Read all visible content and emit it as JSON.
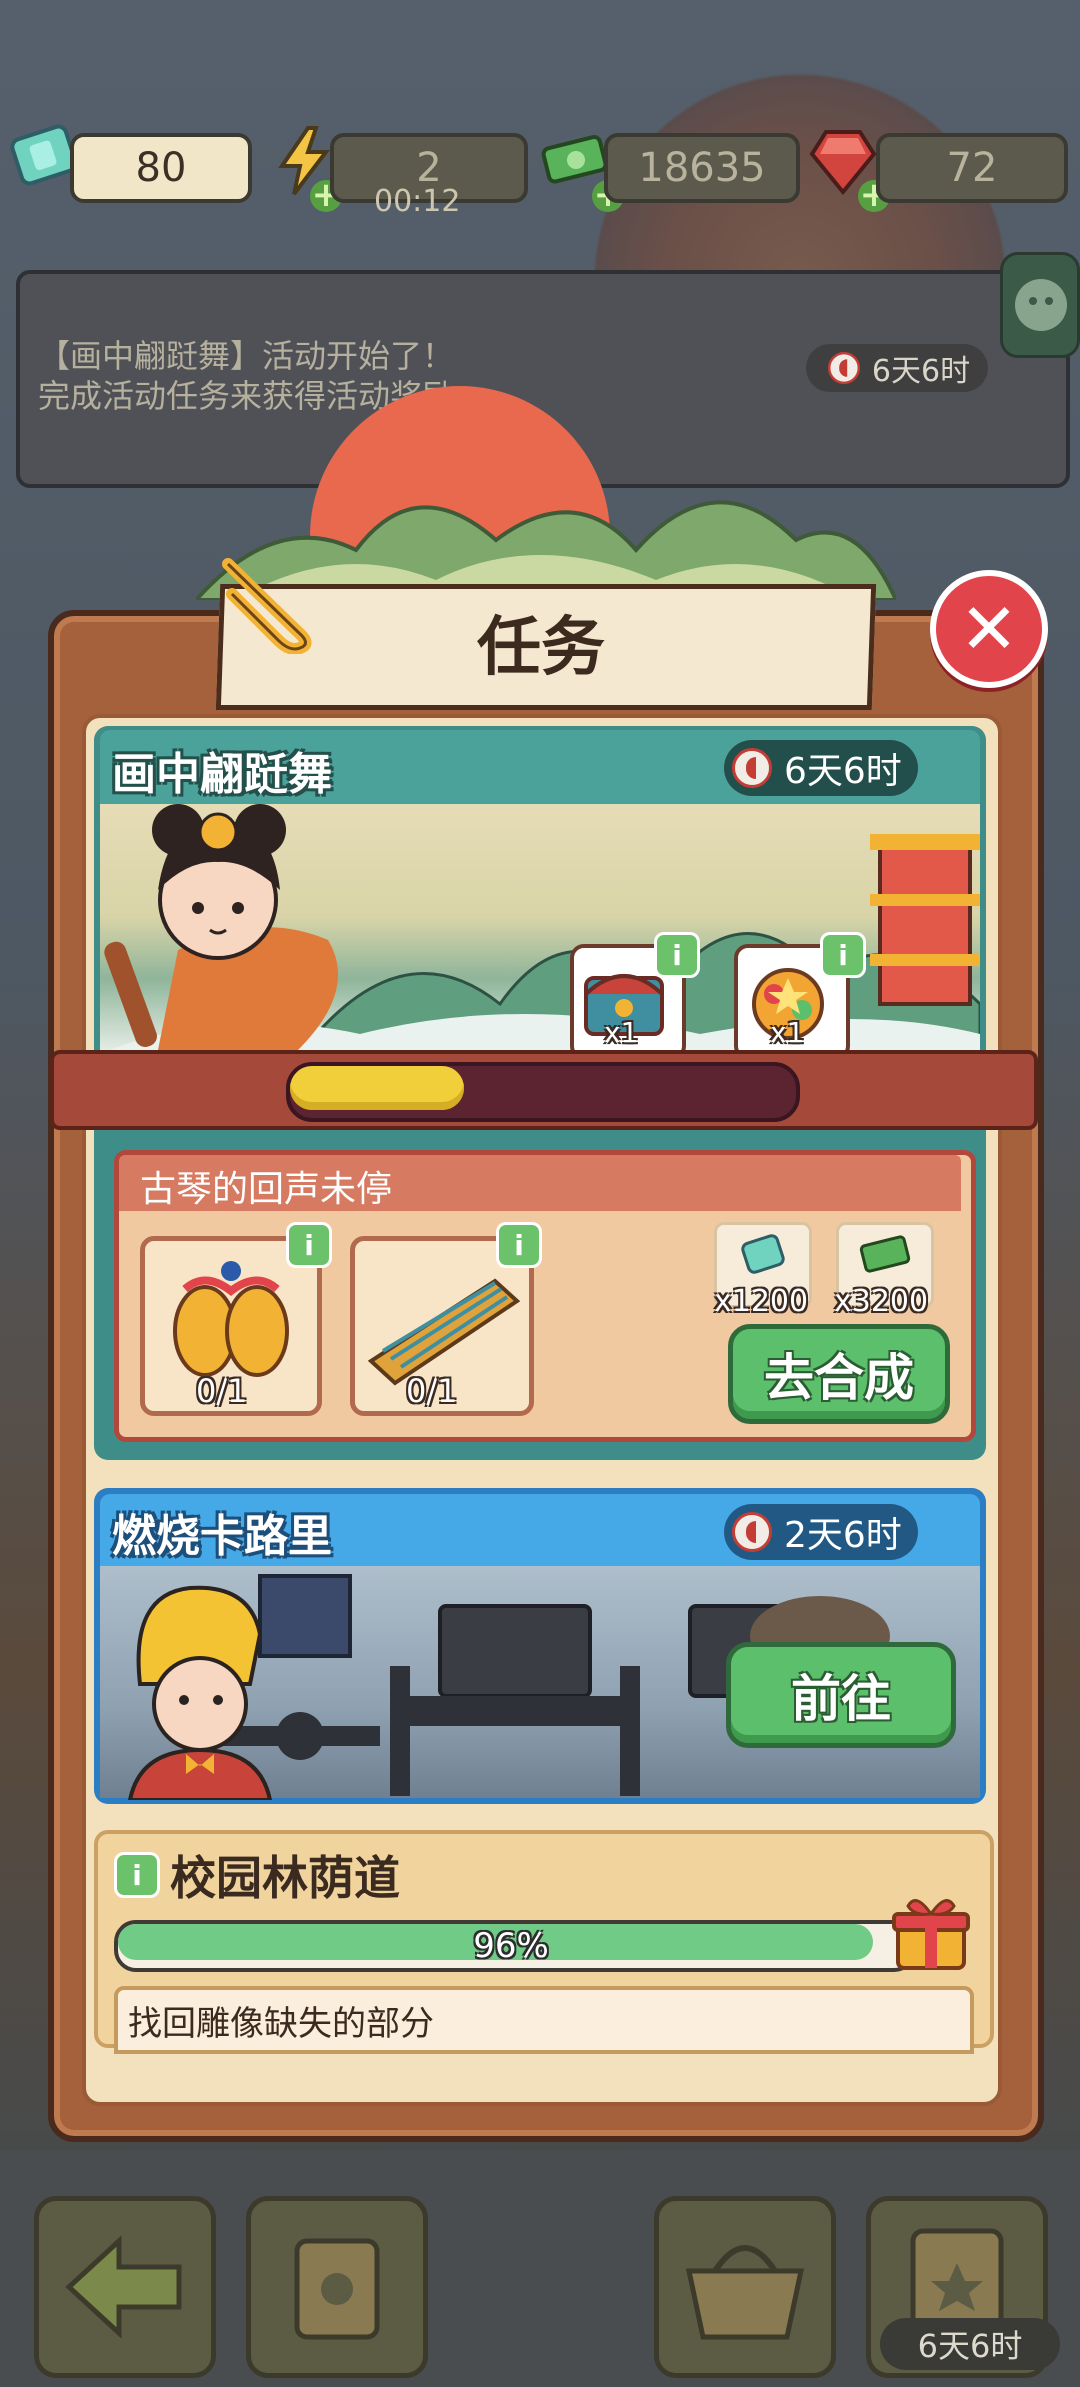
{
  "resources": {
    "ticket": "80",
    "energy": "2",
    "energy_timer": "00:12",
    "cash": "18635",
    "gem": "72"
  },
  "banner": {
    "line1": "【画中翩跹舞】活动开始了！",
    "line2": "完成活动任务来获得活动奖励",
    "timer": "6天6时"
  },
  "panel": {
    "title": "任务",
    "close_icon": "close-icon"
  },
  "event_task": {
    "title": "画中翩跹舞",
    "timer": "6天6时",
    "progress": 0.35,
    "rewards": [
      {
        "icon": "treasure-chest-icon",
        "count": "x1"
      },
      {
        "icon": "gift-pack-icon",
        "count": "x1"
      }
    ],
    "subtask": {
      "title": "古琴的回声未停",
      "items": [
        {
          "icon": "golden-fish-ornament-icon",
          "count": "0/1"
        },
        {
          "icon": "guqin-instrument-icon",
          "count": "0/1"
        }
      ],
      "rewards": [
        {
          "icon": "ticket-icon",
          "count": "x1200"
        },
        {
          "icon": "cash-icon",
          "count": "x3200"
        }
      ],
      "button": "去合成"
    }
  },
  "gym_task": {
    "title": "燃烧卡路里",
    "timer": "2天6时",
    "button": "前往"
  },
  "campus_task": {
    "title": "校园林荫道",
    "percent": "96%",
    "progress": 0.96,
    "subtask_title": "找回雕像缺失的部分"
  },
  "bottom_bar": {
    "timer": "6天6时"
  },
  "colors": {
    "accent_green": "#5cbf6b",
    "close_red": "#e2444b",
    "event_teal": "#4aa29a",
    "gym_blue": "#45a9e8"
  }
}
